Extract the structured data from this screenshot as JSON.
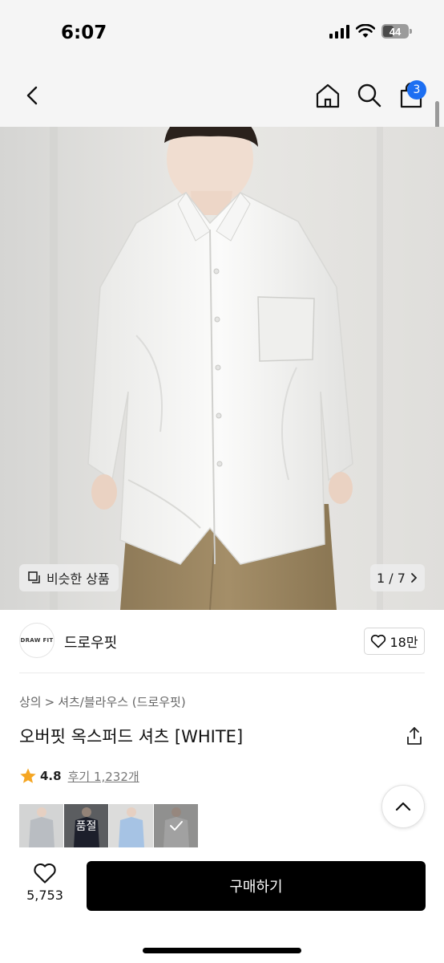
{
  "status_bar": {
    "time": "6:07",
    "battery": "44",
    "battery_level": 0.44
  },
  "nav": {
    "cart_count": "3",
    "icons": [
      "chevron-left-icon",
      "home-icon",
      "search-icon",
      "shopping-bag-icon"
    ]
  },
  "hero": {
    "similar_label": "비슷한 상품",
    "image_index": "1 / 7"
  },
  "brand": {
    "logo_text": "DRAW FIT",
    "name": "드로우핏",
    "like_count": "18만"
  },
  "breadcrumb": {
    "level1": "상의",
    "separator": ">",
    "level2": "셔츠/블라우스 (드로우핏)"
  },
  "product": {
    "title": "오버핏 옥스퍼드 셔츠 [WHITE]",
    "rating": "4.8",
    "reviews": "후기 1,232개"
  },
  "color_options": [
    {
      "name": "grey",
      "label": ""
    },
    {
      "name": "navy",
      "label": "품절"
    },
    {
      "name": "blue",
      "label": ""
    },
    {
      "name": "white",
      "label": ""
    }
  ],
  "bottom_bar": {
    "like_count": "5,753",
    "buy_label": "구매하기"
  },
  "colors": {
    "primary": "#000000",
    "badge": "#1d6ff2",
    "star": "#f5a623"
  }
}
